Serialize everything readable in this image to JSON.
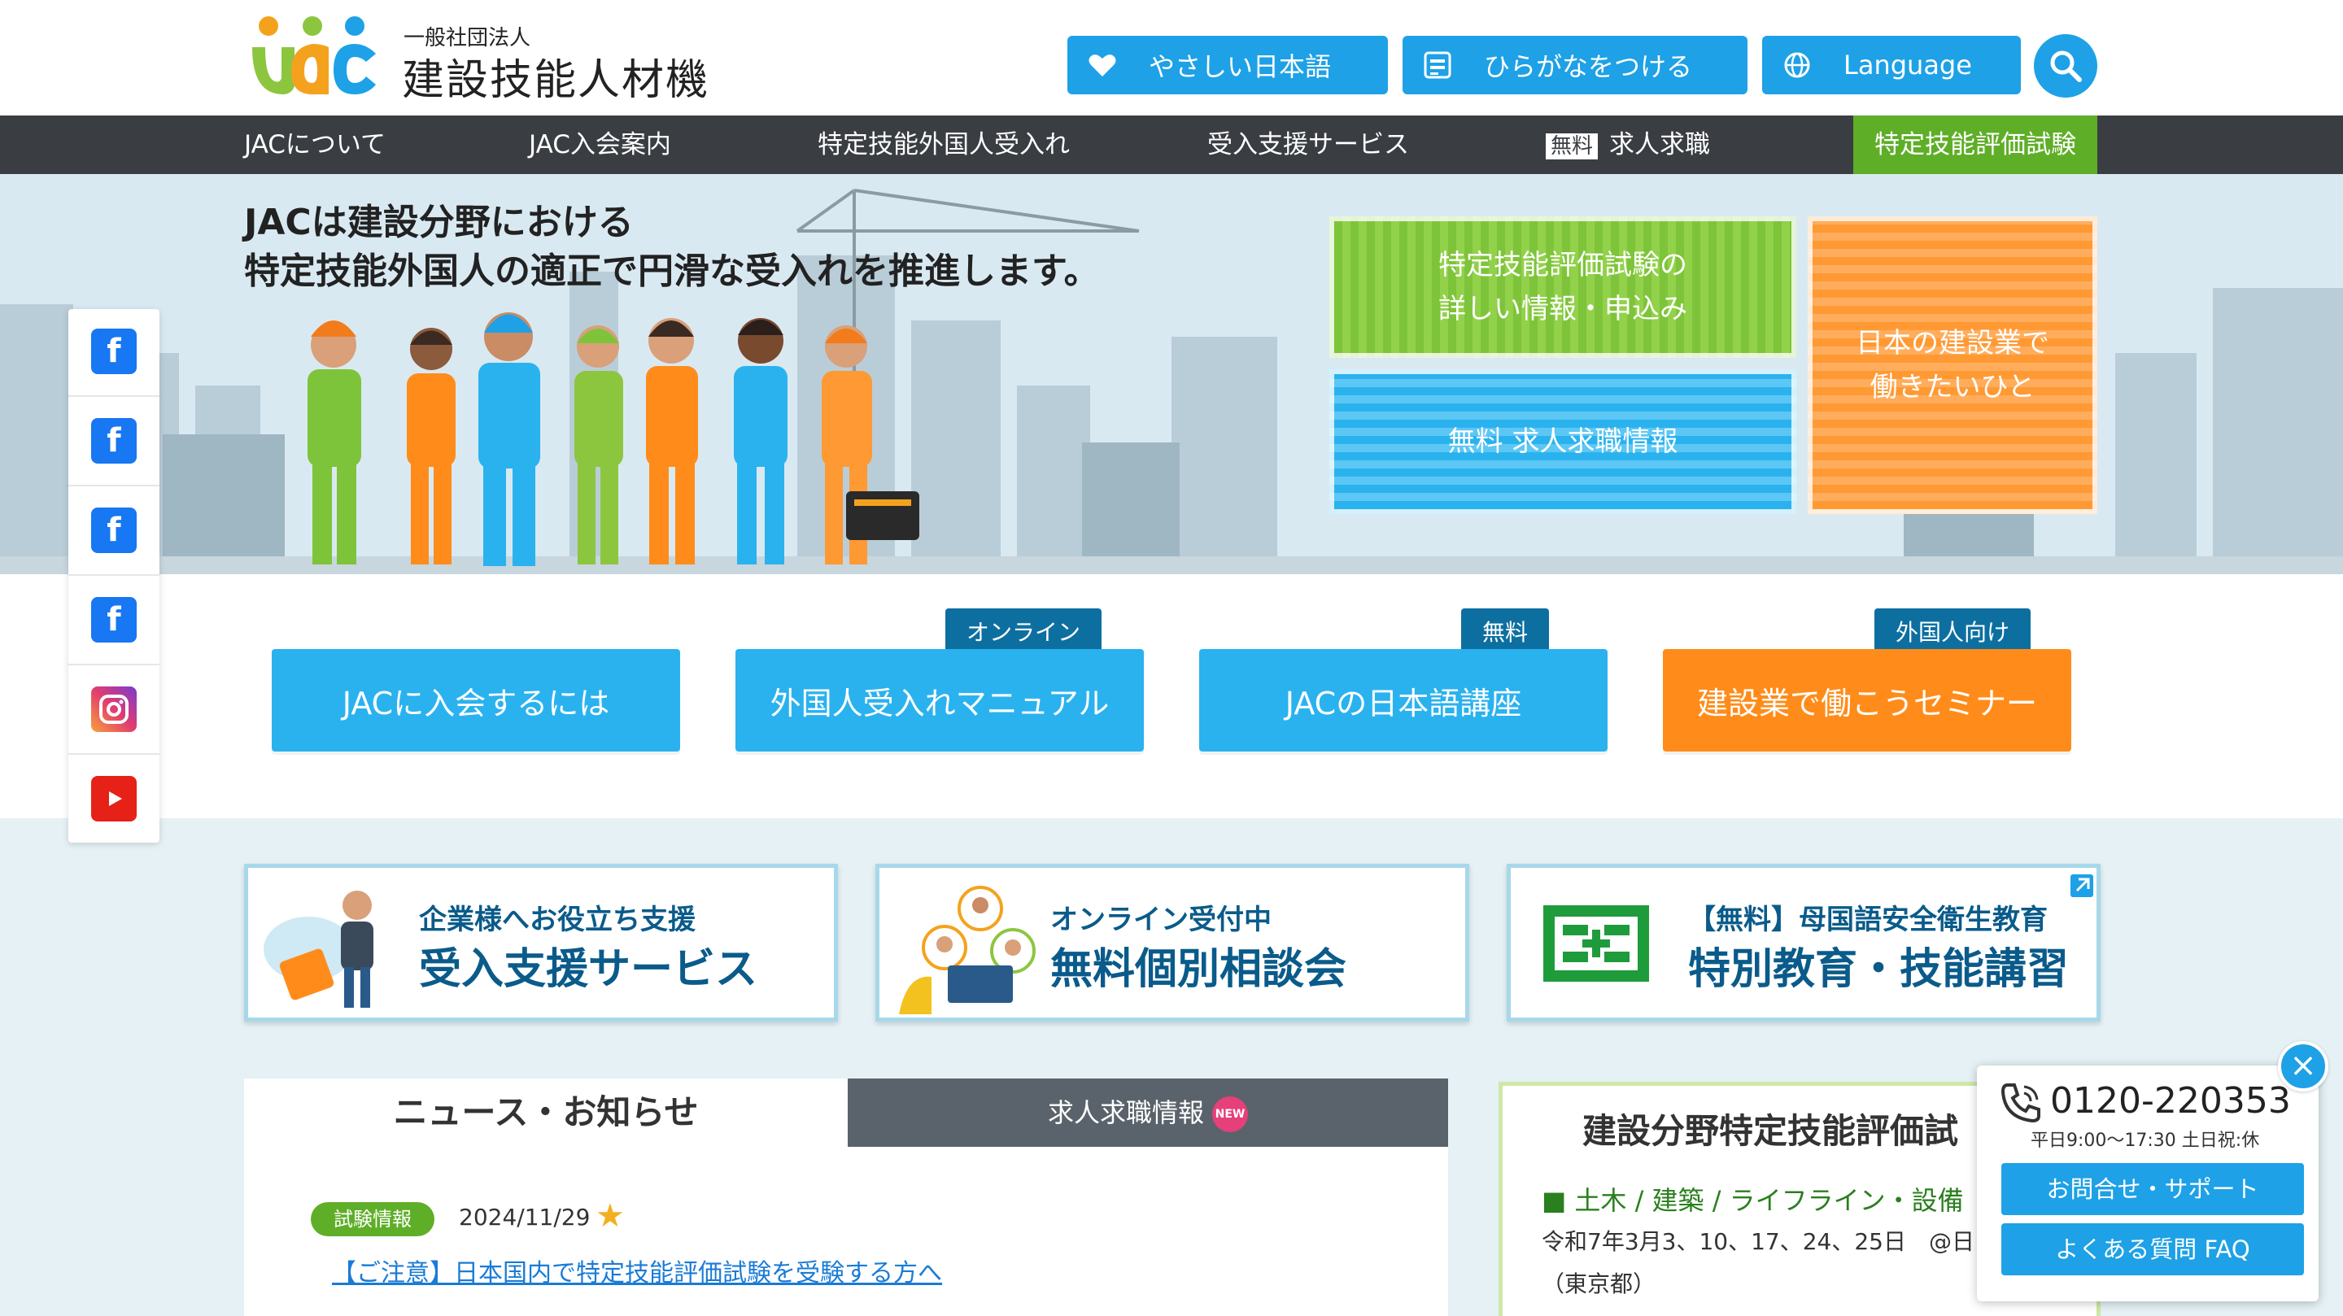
{
  "brand": {
    "sub": "一般社団法人",
    "name": "建設技能人材機構",
    "logo_colors": [
      "#f4a21e",
      "#8cc63f",
      "#1ea1e6"
    ]
  },
  "header_buttons": [
    {
      "label": "やさしい日本語",
      "icon": "heart-icon"
    },
    {
      "label": "ひらがなをつける",
      "icon": "furigana-icon"
    },
    {
      "label": "Language",
      "icon": "globe-icon"
    }
  ],
  "nav": {
    "items": [
      "JACについて",
      "JAC入会案内",
      "特定技能外国人受入れ",
      "受入支援サービス"
    ],
    "jobs_badge": "無料",
    "jobs_label": "求人求職",
    "exam_label": "特定技能評価試験"
  },
  "hero": {
    "line1": "JACは建設分野における",
    "line2": "特定技能外国人の適正で円滑な受入れを推進します。",
    "tile_green_1": "特定技能評価試験の",
    "tile_green_2": "詳しい情報・申込み",
    "tile_blue": "無料 求人求職情報",
    "tile_orange_1": "日本の建設業で",
    "tile_orange_2": "働きたいひと"
  },
  "big_buttons": [
    {
      "label": "JACに入会するには",
      "tag": ""
    },
    {
      "label": "外国人受入れマニュアル",
      "tag": "オンライン"
    },
    {
      "label": "JACの日本語講座",
      "tag": "無料"
    },
    {
      "label": "建設業で働こうセミナー",
      "tag": "外国人向け"
    }
  ],
  "social": [
    "facebook-jp-icon",
    "facebook-id-icon",
    "facebook-vn-icon",
    "facebook-ph-icon",
    "instagram-icon",
    "youtube-icon"
  ],
  "cards": [
    {
      "sub": "企業様へお役立ち支援",
      "main": "受入支援サービス"
    },
    {
      "sub": "オンライン受付中",
      "main": "無料個別相談会"
    },
    {
      "sub": "【無料】母国語安全衛生教育",
      "main": "特別教育・技能講習"
    }
  ],
  "news": {
    "tab_news": "ニュース・お知らせ",
    "tab_jobs": "求人求職情報",
    "new_badge": "NEW",
    "item_tag": "試験情報",
    "item_date": "2024/11/29",
    "item_title": "【ご注意】日本国内で特定技能評価試験を受験する方へ"
  },
  "exam": {
    "title": "建設分野特定技能評価試",
    "category": "■ 土木 / 建築 / ライフライン・設備",
    "line1": "令和7年3月3、10、17、24、25日　@日",
    "line2": "（東京都）"
  },
  "phone": {
    "number": "0120-220353",
    "hours": "平日9:00〜17:30 土日祝:休",
    "btn_support": "お問合せ・サポート",
    "btn_faq": "よくある質問 FAQ"
  },
  "colors": {
    "accent": "#1ea1e6",
    "nav_bg": "#3a3d42",
    "green": "#5fae28",
    "orange": "#ff8c1a",
    "dark_blue": "#0a5b8a"
  }
}
